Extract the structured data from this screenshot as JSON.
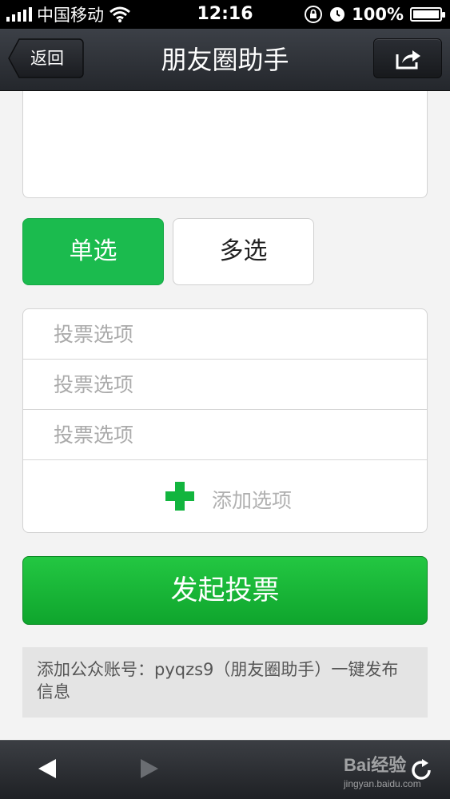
{
  "status_bar": {
    "carrier": "中国移动",
    "time": "12:16",
    "battery": "100%"
  },
  "nav": {
    "back_label": "返回",
    "title": "朋友圈助手"
  },
  "vote_type": {
    "single_label": "单选",
    "multi_label": "多选",
    "selected": "单选"
  },
  "options": {
    "placeholder": "投票选项",
    "rows": [
      {
        "value": ""
      },
      {
        "value": ""
      },
      {
        "value": ""
      }
    ],
    "add_label": "添加选项"
  },
  "submit_label": "发起投票",
  "tip_text": "添加公众账号：pyqzs9（朋友圈助手）一键发布信息",
  "watermark": {
    "brand": "Bai经验",
    "url": "jingyan.baidu.com"
  },
  "colors": {
    "accent_green": "#1bbb4e",
    "submit_green": "#14b436",
    "navbar": "#2e3137"
  },
  "icons": {
    "share": "share-icon",
    "back": "back-arrow-icon",
    "forward": "forward-arrow-icon",
    "refresh": "refresh-icon",
    "add": "plus-icon"
  }
}
